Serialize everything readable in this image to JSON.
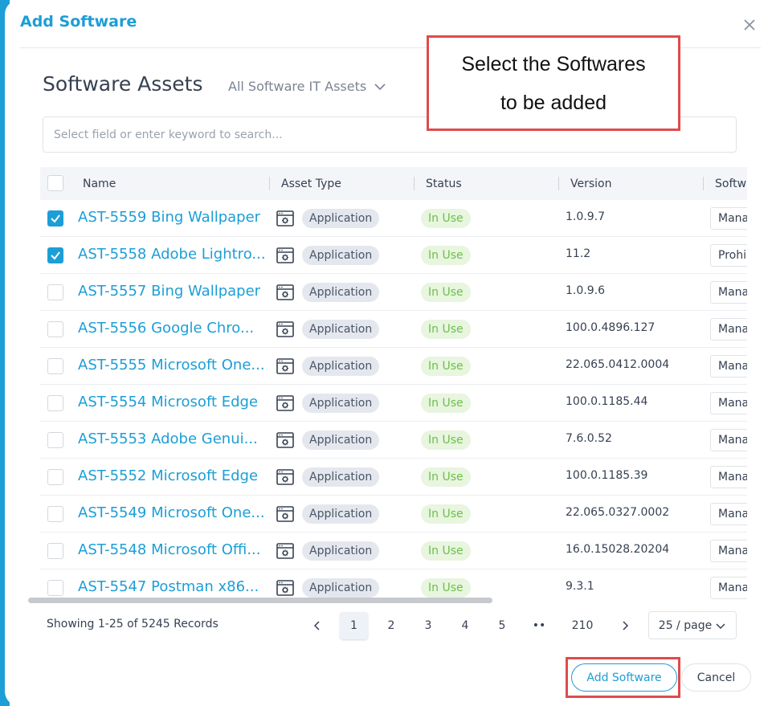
{
  "modal": {
    "title": "Add Software",
    "close_icon": "close-icon"
  },
  "section": {
    "title": "Software Assets",
    "filter_label": "All Software IT Assets"
  },
  "search": {
    "placeholder": "Select field or enter keyword to search..."
  },
  "table": {
    "columns": [
      "Name",
      "Asset Type",
      "Status",
      "Version",
      "Softwa"
    ],
    "rows": [
      {
        "checked": true,
        "name": "AST-5559 Bing Wallpaper",
        "type": "Application",
        "status": "In Use",
        "version": "1.0.9.7",
        "software_type": "Mana"
      },
      {
        "checked": true,
        "name": "AST-5558 Adobe Lightro...",
        "type": "Application",
        "status": "In Use",
        "version": "11.2",
        "software_type": "Prohi"
      },
      {
        "checked": false,
        "name": "AST-5557 Bing Wallpaper",
        "type": "Application",
        "status": "In Use",
        "version": "1.0.9.6",
        "software_type": "Mana"
      },
      {
        "checked": false,
        "name": "AST-5556 Google Chro...",
        "type": "Application",
        "status": "In Use",
        "version": "100.0.4896.127",
        "software_type": "Mana"
      },
      {
        "checked": false,
        "name": "AST-5555 Microsoft One...",
        "type": "Application",
        "status": "In Use",
        "version": "22.065.0412.0004",
        "software_type": "Mana"
      },
      {
        "checked": false,
        "name": "AST-5554 Microsoft Edge",
        "type": "Application",
        "status": "In Use",
        "version": "100.0.1185.44",
        "software_type": "Mana"
      },
      {
        "checked": false,
        "name": "AST-5553 Adobe Genui...",
        "type": "Application",
        "status": "In Use",
        "version": "7.6.0.52",
        "software_type": "Mana"
      },
      {
        "checked": false,
        "name": "AST-5552 Microsoft Edge",
        "type": "Application",
        "status": "In Use",
        "version": "100.0.1185.39",
        "software_type": "Mana"
      },
      {
        "checked": false,
        "name": "AST-5549 Microsoft One...",
        "type": "Application",
        "status": "In Use",
        "version": "22.065.0327.0002",
        "software_type": "Mana"
      },
      {
        "checked": false,
        "name": "AST-5548 Microsoft Offi...",
        "type": "Application",
        "status": "In Use",
        "version": "16.0.15028.20204",
        "software_type": "Mana"
      },
      {
        "checked": false,
        "name": "AST-5547 Postman x86...",
        "type": "Application",
        "status": "In Use",
        "version": "9.3.1",
        "software_type": "Mana"
      }
    ]
  },
  "pagination": {
    "summary": "Showing 1-25 of 5245 Records",
    "pages": [
      "1",
      "2",
      "3",
      "4",
      "5",
      "••",
      "210"
    ],
    "current_page": "1",
    "page_size": "25 / page"
  },
  "footer": {
    "add_label": "Add Software",
    "cancel_label": "Cancel"
  },
  "annotation": {
    "line1": "Select the Softwares",
    "line2": "to be added"
  },
  "colors": {
    "accent": "#1c9ed7",
    "status_green": "#6cc04a",
    "highlight_red": "#e04b4b"
  }
}
